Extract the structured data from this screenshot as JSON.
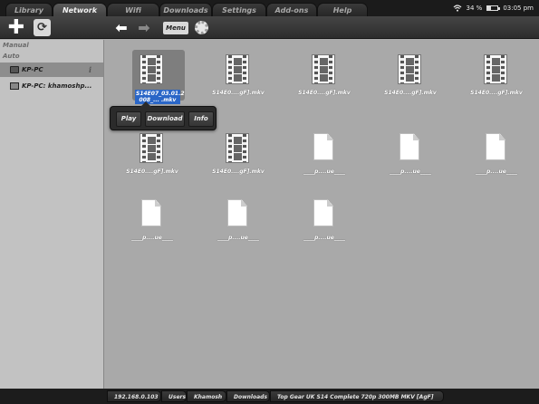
{
  "tabs": [
    {
      "label": "Library",
      "active": false
    },
    {
      "label": "Network",
      "active": true
    },
    {
      "label": "Wifi",
      "active": false
    },
    {
      "label": "Downloads",
      "active": false
    },
    {
      "label": "Settings",
      "active": false
    },
    {
      "label": "Add-ons",
      "active": false
    },
    {
      "label": "Help",
      "active": false
    }
  ],
  "status": {
    "battery": "34 %",
    "battery_level": 0.34,
    "time": "03:05 pm"
  },
  "toolbar": {
    "menu_label": "Menu",
    "add_icon": "plus-icon",
    "refresh_icon": "refresh-icon",
    "back_icon": "arrow-left-icon",
    "forward_icon": "arrow-right-icon",
    "settings_icon": "gear-icon"
  },
  "sidebar": {
    "manual_label": "Manual",
    "auto_label": "Auto",
    "items": [
      {
        "label": "KP-PC",
        "icon": "monitor-icon",
        "info": "i"
      },
      {
        "label": "KP-PC: khamoshp...",
        "icon": "hard-drive-icon"
      }
    ]
  },
  "files": [
    {
      "name": "S14E07_03.01.2 008_... .mkv",
      "type": "video",
      "selected": true
    },
    {
      "name": "S14E0....gF].mkv",
      "type": "video"
    },
    {
      "name": "S14E0....gF].mkv",
      "type": "video"
    },
    {
      "name": "S14E0....gF].mkv",
      "type": "video"
    },
    {
      "name": "S14E0....gF].mkv",
      "type": "video"
    },
    {
      "name": "S14E0....gF].mkv",
      "type": "video"
    },
    {
      "name": "S14E0....gF].mkv",
      "type": "video"
    },
    {
      "name": "____p....ue____",
      "type": "doc"
    },
    {
      "name": "____p....ue____",
      "type": "doc"
    },
    {
      "name": "____p....ue____",
      "type": "doc"
    },
    {
      "name": "____p....ue____",
      "type": "doc"
    },
    {
      "name": "____p....ue____",
      "type": "doc"
    },
    {
      "name": "____p....ue____",
      "type": "doc"
    }
  ],
  "popup": {
    "play": "Play",
    "download": "Download",
    "info": "Info"
  },
  "path": [
    "192.168.0.103",
    "Users",
    "Khamosh",
    "Downloads",
    "Top Gear UK S14 Complete 720p 300MB MKV [AgF]"
  ],
  "colors": {
    "selection": "#2a66c7",
    "background": "#a9a9a9",
    "sidebar": "#c2c2c2"
  }
}
